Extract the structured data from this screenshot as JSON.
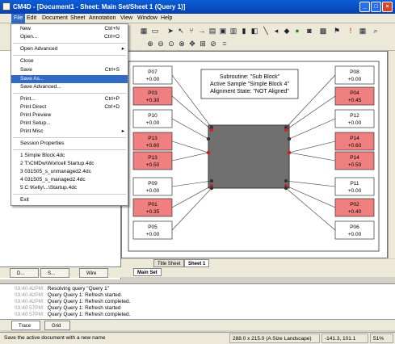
{
  "window": {
    "title": "CM4D - [Document1 - Sheet: Main Set/Sheet 1 (Query 1)]",
    "min": "_",
    "max": "□",
    "close": "×"
  },
  "menubar": [
    "File",
    "Edit",
    "Document",
    "Sheet",
    "Annotation",
    "View",
    "Window",
    "Help"
  ],
  "file_menu": {
    "items": [
      {
        "label": "New",
        "shortcut": "Ctrl+N"
      },
      {
        "label": "Open...",
        "shortcut": "Ctrl+O"
      },
      {
        "label": "Open Advanced",
        "submenu": "▸"
      },
      {
        "label": "Close"
      },
      {
        "label": "Save",
        "shortcut": "Ctrl+S"
      },
      {
        "label": "Save As..."
      },
      {
        "label": "Save Advanced..."
      },
      {
        "label": "Print...",
        "shortcut": "Ctrl+P"
      },
      {
        "label": "Print Direct",
        "shortcut": "Ctrl+D"
      },
      {
        "label": "Print Preview"
      },
      {
        "label": "Print Setup..."
      },
      {
        "label": "Print Misc",
        "submenu": "▸"
      },
      {
        "label": "Session Properties"
      },
      {
        "label": "1 Simple Block.4dc"
      },
      {
        "label": "2 T:\\CMDw\\Worlcell Startup.4dc"
      },
      {
        "label": "3 031505_s_unmanaged2.4dc"
      },
      {
        "label": "4 031505_s_managed2.4dc"
      },
      {
        "label": "5 C:\\Kelly\\...\\Startup.4dc"
      },
      {
        "label": "Exit"
      }
    ]
  },
  "diagram": {
    "info": [
      "Subroutine: \"Sub Block\"",
      "Active Sample \"Simple Block 4\"",
      "Alignment State: \"NOT Aligned\""
    ],
    "left_points": [
      {
        "id": "P07",
        "value": "+0.00",
        "flag": false
      },
      {
        "id": "P03",
        "value": "+0.30",
        "flag": true
      },
      {
        "id": "P10",
        "value": "+0.00",
        "flag": false
      },
      {
        "id": "P13",
        "value": "+0.60",
        "flag": true
      },
      {
        "id": "P13",
        "value": "+0.50",
        "flag": true
      },
      {
        "id": "P09",
        "value": "+0.00",
        "flag": false
      },
      {
        "id": "P01",
        "value": "+0.35",
        "flag": true
      },
      {
        "id": "P05",
        "value": "+0.00",
        "flag": false
      }
    ],
    "right_points": [
      {
        "id": "P08",
        "value": "+0.00",
        "flag": false
      },
      {
        "id": "P04",
        "value": "+0.45",
        "flag": true
      },
      {
        "id": "P12",
        "value": "+0.00",
        "flag": false
      },
      {
        "id": "P14",
        "value": "+0.60",
        "flag": true
      },
      {
        "id": "P14",
        "value": "+0.50",
        "flag": true
      },
      {
        "id": "P11",
        "value": "+0.00",
        "flag": false
      },
      {
        "id": "P02",
        "value": "+0.40",
        "flag": true
      },
      {
        "id": "P06",
        "value": "+0.00",
        "flag": false
      }
    ],
    "colors": {
      "flag": "#f08080",
      "ok": "#ffffff",
      "block": "#707070"
    }
  },
  "sheet_tabs": [
    "Title Sheet",
    "Sheet 1"
  ],
  "set_tab": "Main Set",
  "sidebar_tabs": [
    "D...",
    "S...",
    "Wire"
  ],
  "log": [
    {
      "time": "03:40:42PM:",
      "text": "Resolving query \"Query 1\""
    },
    {
      "time": "03:40:42PM:",
      "text": "Query Query 1: Refresh started."
    },
    {
      "time": "03:40:42PM:",
      "text": "Query Query 1: Refresh completed."
    },
    {
      "time": "03:40:57PM:",
      "text": "Query Query 1: Refresh started"
    },
    {
      "time": "03:40:57PM:",
      "text": "Query Query 1: Refresh completed."
    }
  ],
  "log_tabs": [
    "Trace",
    "Grid"
  ],
  "status": {
    "message": "Save the active document with a new name",
    "size": "288.0 x 215.0 (A Size Landscape)",
    "coords": "-141.3,  101.1",
    "zoom": "51%"
  }
}
